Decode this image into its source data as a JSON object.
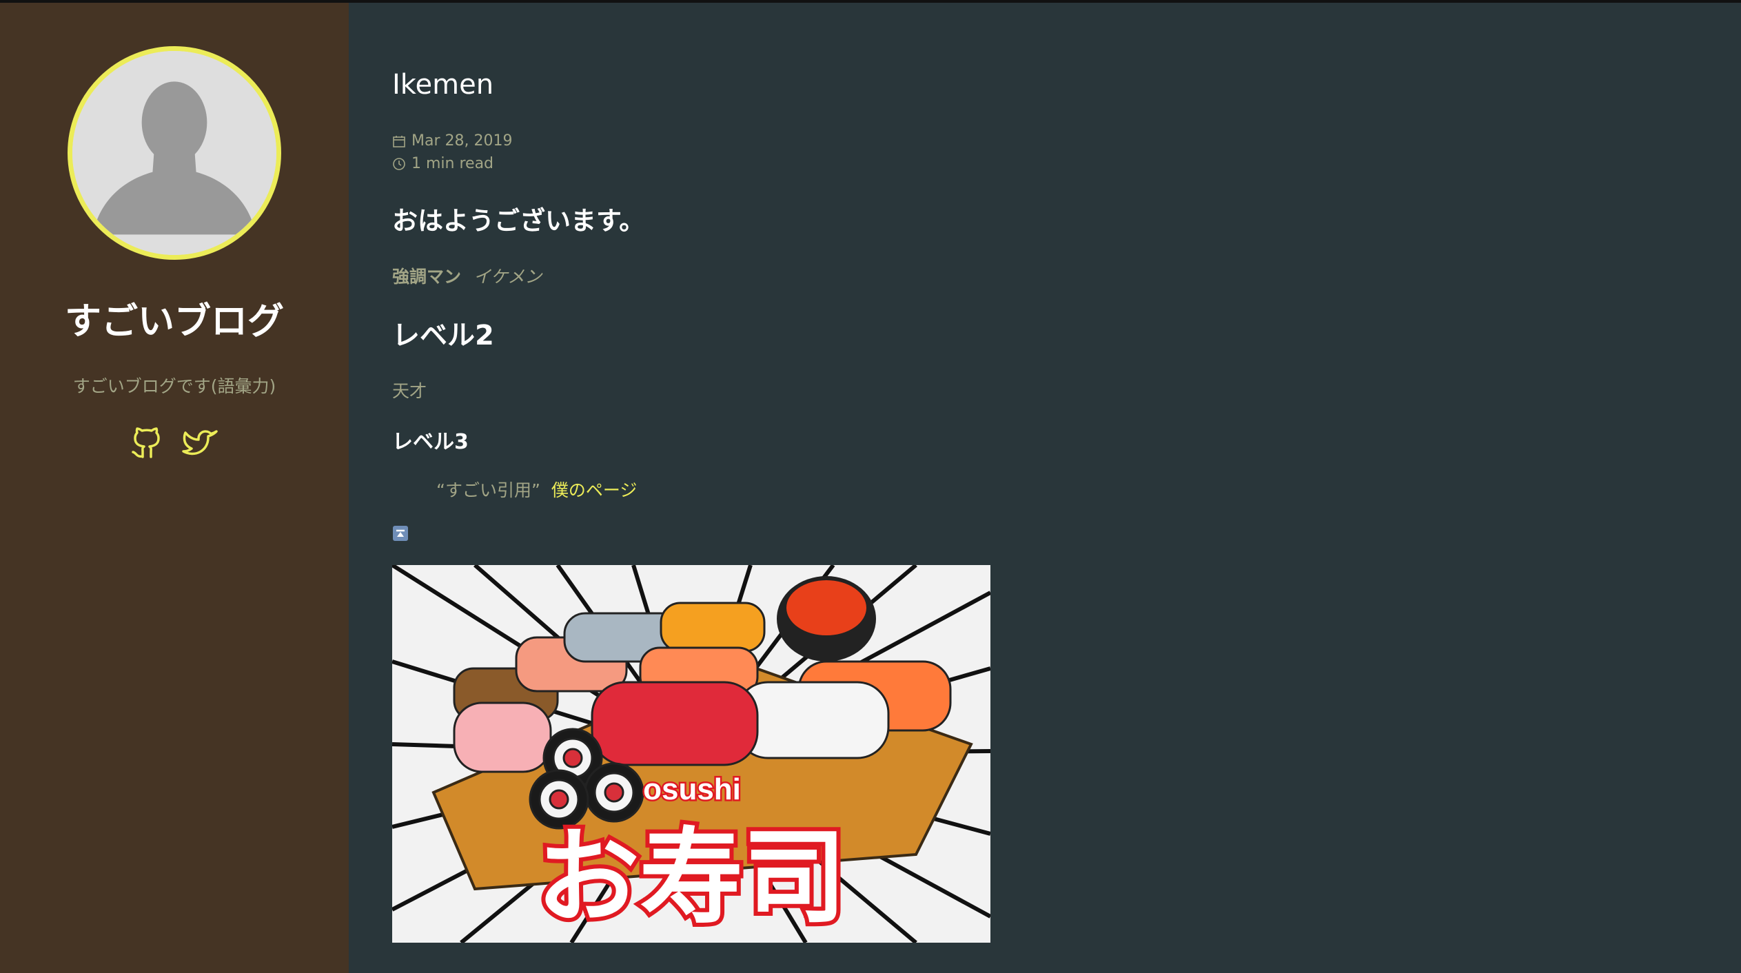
{
  "site": {
    "title": "すごいブログ",
    "description": "すごいブログです(語彙力)"
  },
  "social": {
    "github_icon": "github-icon",
    "twitter_icon": "twitter-icon"
  },
  "post": {
    "title": "Ikemen",
    "date": "Mar 28, 2019",
    "read_time": "1 min read",
    "greeting_heading": "おはようございます。",
    "strong_text": "強調マン",
    "italic_text": "イケメン",
    "level2_heading": "レベル2",
    "genius_text": "天才",
    "level3_heading": "レベル3",
    "quote_text": "“すごい引用”",
    "quote_link": "僕のページ",
    "image_caption_small": "osushi",
    "image_caption_large": "お寿司"
  },
  "colors": {
    "sidebar": "#453424",
    "main": "#29363a",
    "accent": "#ecec58",
    "muted": "#a2a586"
  }
}
